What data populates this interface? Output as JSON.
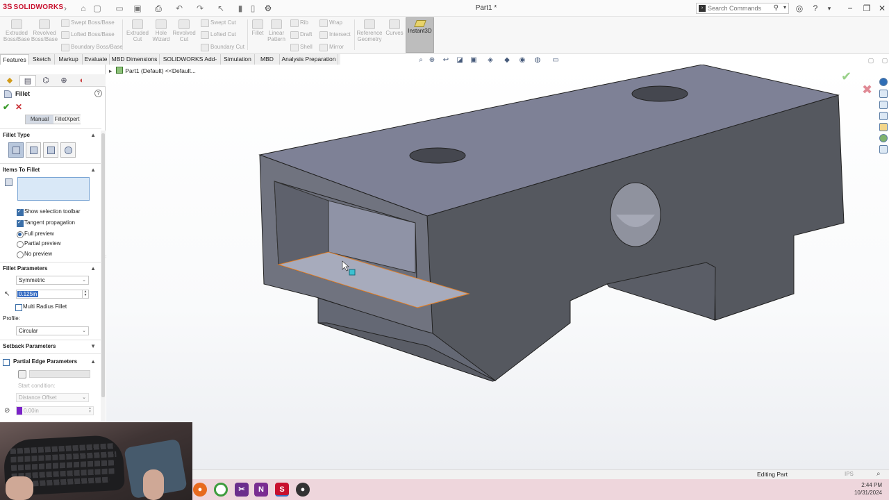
{
  "app": {
    "brand": "SOLIDWORKS",
    "document_title": "Part1 *",
    "search_placeholder": "Search Commands"
  },
  "command_manager": {
    "tools": [
      {
        "label": "Extruded Boss/Base"
      },
      {
        "label": "Revolved Boss/Base"
      },
      {
        "label": "Swept Boss/Base"
      },
      {
        "label": "Lofted Boss/Base"
      },
      {
        "label": "Boundary Boss/Base"
      },
      {
        "label": "Extruded Cut"
      },
      {
        "label": "Hole Wizard"
      },
      {
        "label": "Revolved Cut"
      },
      {
        "label": "Swept Cut"
      },
      {
        "label": "Lofted Cut"
      },
      {
        "label": "Boundary Cut"
      },
      {
        "label": "Fillet"
      },
      {
        "label": "Linear Pattern"
      },
      {
        "label": "Rib"
      },
      {
        "label": "Draft"
      },
      {
        "label": "Shell"
      },
      {
        "label": "Wrap"
      },
      {
        "label": "Intersect"
      },
      {
        "label": "Mirror"
      },
      {
        "label": "Reference Geometry"
      },
      {
        "label": "Curves"
      },
      {
        "label": "Instant3D"
      }
    ]
  },
  "tabs": [
    "Features",
    "Sketch",
    "Markup",
    "Evaluate",
    "MBD Dimensions",
    "SOLIDWORKS Add-Ins",
    "Simulation",
    "MBD",
    "Analysis Preparation"
  ],
  "active_tab": "Features",
  "property_manager": {
    "title": "Fillet",
    "mode_manual": "Manual",
    "mode_xpert": "FilletXpert",
    "fillet_type_header": "Fillet Type",
    "items_header": "Items To Fillet",
    "show_selection_toolbar": "Show selection toolbar",
    "tangent_propagation": "Tangent propagation",
    "full_preview": "Full preview",
    "partial_preview": "Partial preview",
    "no_preview": "No preview",
    "params_header": "Fillet Parameters",
    "symmetric": "Symmetric",
    "radius": "0.125in",
    "multi_radius": "Multi Radius Fillet",
    "profile_label": "Profile:",
    "profile_value": "Circular",
    "setback_header": "Setback Parameters",
    "partial_edge_header": "Partial Edge Parameters",
    "start_condition": "Start condition:",
    "distance_offset": "Distance Offset",
    "offset_value": "0.00in"
  },
  "feature_tree": {
    "root": "Part1 (Default) <<Default..."
  },
  "status": {
    "editing": "Editing Part",
    "units": "IPS"
  },
  "taskbar": {
    "time": "2:44 PM",
    "date": "10/31/2024"
  },
  "colors": {
    "top_face": "#7e8196",
    "front_face": "#70737f",
    "right_face": "#55585f",
    "edge_preview": "#e0802c",
    "brand": "#c8102e"
  }
}
